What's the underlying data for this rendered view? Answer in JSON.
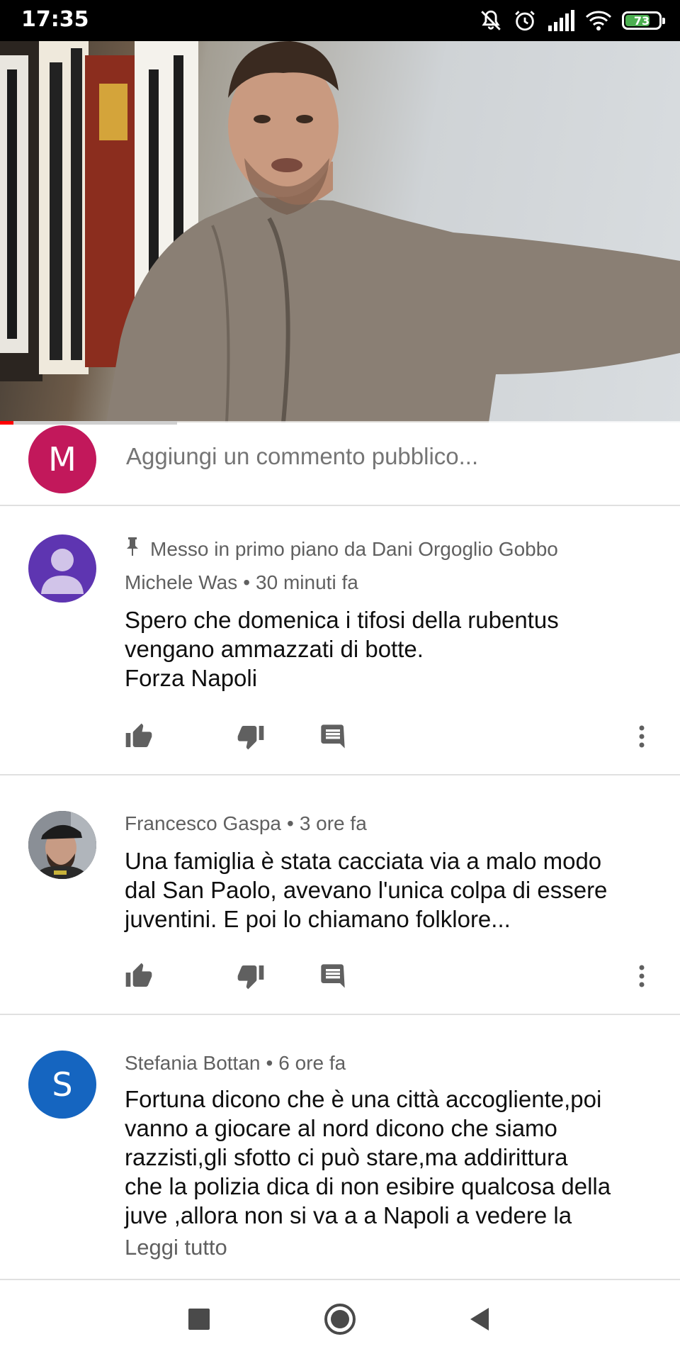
{
  "status_bar": {
    "time": "17:35",
    "battery_level": "73",
    "icons": [
      "mute-icon",
      "alarm-icon",
      "signal-icon",
      "wifi-icon",
      "battery-icon"
    ]
  },
  "video": {
    "progress_played": 0.02,
    "progress_buffered": 0.26
  },
  "composer": {
    "avatar_letter": "M",
    "placeholder": "Aggiungi un commento pubblico..."
  },
  "comments": [
    {
      "pinned_text": "Messo in primo piano da Dani Orgoglio Gobbo",
      "author": "Michele Was",
      "separator": "•",
      "time": "30 minuti fa",
      "text": "Spero che domenica i tifosi della rubentus\nvengano ammazzati di botte.\nForza Napoli",
      "avatar_color": "#5e35b1"
    },
    {
      "author": "Francesco Gaspa",
      "separator": "•",
      "time": "3 ore fa",
      "text": "Una famiglia è stata cacciata via a malo modo\ndal San Paolo, avevano l'unica colpa di essere\njuventini. E poi lo chiamano folklore..."
    },
    {
      "author": "Stefania Bottan",
      "separator": "•",
      "time": "6 ore fa",
      "avatar_letter": "S",
      "avatar_color": "#1565c0",
      "text": "Fortuna dicono che è una città  accogliente,poi\nvanno a giocare al nord dicono che siamo\nrazzisti,gli sfotto ci può stare,ma addirittura\nche la polizia dica di non esibire qualcosa della\njuve ,allora non si va a a Napoli a vedere la",
      "read_more": "Leggi tutto"
    }
  ],
  "nav_bar": {
    "icons": [
      "recents-icon",
      "home-icon",
      "back-icon"
    ]
  }
}
